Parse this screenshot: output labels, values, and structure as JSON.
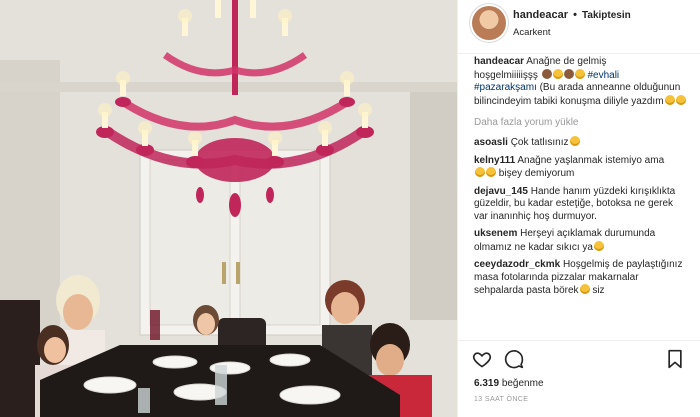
{
  "post": {
    "username": "handeacar",
    "separator": "•",
    "follow_label": "Takiptesin",
    "location": "Acarkent"
  },
  "caption": {
    "username": "handeacar",
    "line1": "Anağne de gelmiş",
    "line2": "hoşgelmiiiiişşş",
    "tag1": "#evhali",
    "tag2": "#pazarakşamı",
    "text": "(Bu arada anneanne olduğunun bilincindeyim tabiki konuşma diliyle yazdım"
  },
  "load_more_label": "Daha fazla yorum yükle",
  "comments": [
    {
      "user": "asoasli",
      "text": "Çok tatlısınız"
    },
    {
      "user": "kelny111",
      "text": "Anağne yaşlanmak istemiyo ama",
      "text2": "bişey demiyorum"
    },
    {
      "user": "dejavu_145",
      "text": "Hande hanım yüzdeki kırışıklıkta güzeldir, bu kadar esteţiğe, botoksa ne gerek var inanınhiç hoş durmuyor."
    },
    {
      "user": "uksenem",
      "text": "Herşeyi açıklamak durumunda olmamız ne kadar sıkıcı ya"
    },
    {
      "user": "ceeydazodr_ckmk",
      "text": "Hoşgelmiş de paylaştığınız masa fotolarında pizzalar makarnalar sehpalarda pasta börek",
      "text2": "siz"
    }
  ],
  "likes": {
    "count": "6.319",
    "label": "beğenme"
  },
  "timestamp": "13 SAAT ÖNCE",
  "icons": [
    "heart-icon",
    "comment-icon",
    "bookmark-icon"
  ],
  "colors": {
    "chandelier": "#c0265a",
    "link": "#003569",
    "muted": "#999999"
  }
}
